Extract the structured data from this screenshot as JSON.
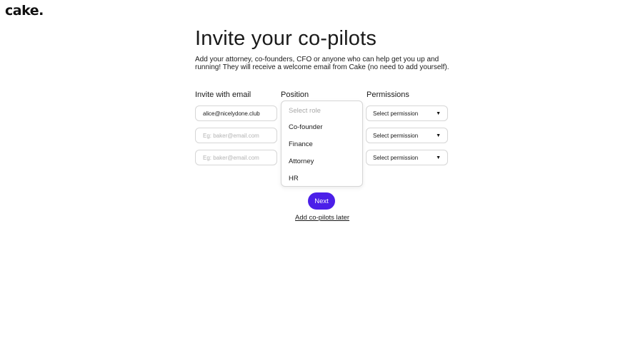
{
  "brand": {
    "logo": "cake."
  },
  "header": {
    "title": "Invite your co-pilots",
    "subtitle": "Add your attorney, co-founders, CFO or anyone who can help get you up and running! They will receive a welcome email from Cake (no need to add yourself)."
  },
  "columns": {
    "email": "Invite with email",
    "position": "Position",
    "permissions": "Permissions"
  },
  "rows": [
    {
      "email_value": "alice@nicelydone.club",
      "email_placeholder": "Eg: baker@email.com",
      "permission": "Select permission"
    },
    {
      "email_value": "",
      "email_placeholder": "Eg: baker@email.com",
      "permission": "Select permission"
    },
    {
      "email_value": "",
      "email_placeholder": "Eg: baker@email.com",
      "permission": "Select permission"
    }
  ],
  "position_dropdown": {
    "placeholder": "Select role",
    "options": [
      "Co-founder",
      "Finance",
      "Attorney",
      "HR"
    ]
  },
  "actions": {
    "next_label": "Next",
    "later_label": "Add co-pilots later"
  },
  "colors": {
    "primary": "#4b1fe8",
    "border": "#d6d6d6"
  },
  "icons": {
    "select_caret": "caret-down-icon"
  }
}
